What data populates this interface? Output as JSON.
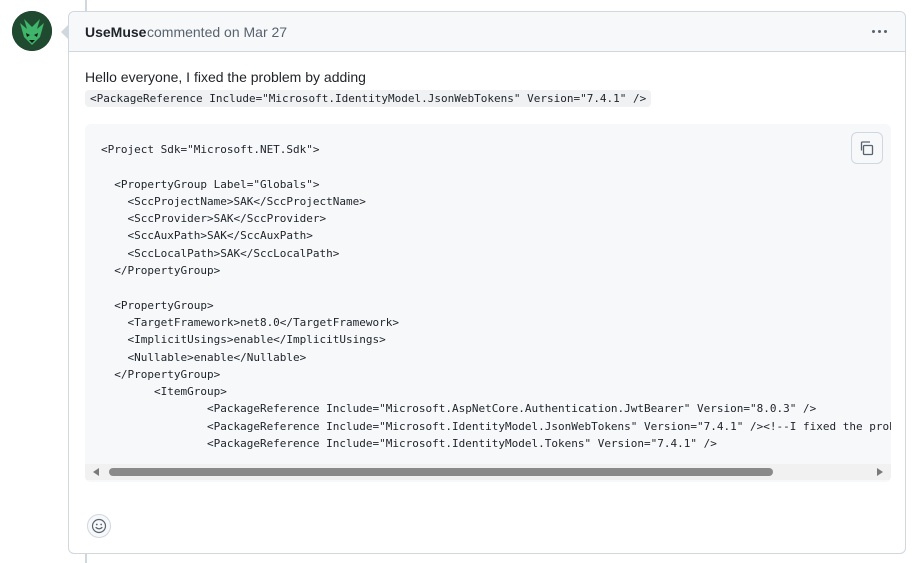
{
  "comment": {
    "author": "UseMuse",
    "action": "commented on",
    "date": "Mar 27",
    "body_text": "Hello everyone, I fixed the problem by adding",
    "inline_code": "<PackageReference Include=\"Microsoft.IdentityModel.JsonWebTokens\" Version=\"7.4.1\" />",
    "code_block": "<Project Sdk=\"Microsoft.NET.Sdk\">\n\n  <PropertyGroup Label=\"Globals\">\n    <SccProjectName>SAK</SccProjectName>\n    <SccProvider>SAK</SccProvider>\n    <SccAuxPath>SAK</SccAuxPath>\n    <SccLocalPath>SAK</SccLocalPath>\n  </PropertyGroup>\n\n  <PropertyGroup>\n    <TargetFramework>net8.0</TargetFramework>\n    <ImplicitUsings>enable</ImplicitUsings>\n    <Nullable>enable</Nullable>\n  </PropertyGroup>\n        <ItemGroup>\n                <PackageReference Include=\"Microsoft.AspNetCore.Authentication.JwtBearer\" Version=\"8.0.3\" />\n                <PackageReference Include=\"Microsoft.IdentityModel.JsonWebTokens\" Version=\"7.4.1\" /><!--I fixed the probl\n                <PackageReference Include=\"Microsoft.IdentityModel.Tokens\" Version=\"7.4.1\" />",
    "scroll_position": 0
  },
  "icons": {
    "avatar": "avatar-wolf",
    "menu": "kebab-horizontal-icon",
    "copy": "copy-icon",
    "reaction": "smiley-icon",
    "scroll_left": "scroll-left-arrow-icon",
    "scroll_right": "scroll-right-arrow-icon"
  },
  "colors": {
    "header_bg": "#f6f8fa",
    "border": "#d0d7de",
    "text": "#1f2328",
    "muted": "#59636e",
    "code_bg": "#f6f8fa",
    "inline_code_bg": "#eff1f3"
  }
}
